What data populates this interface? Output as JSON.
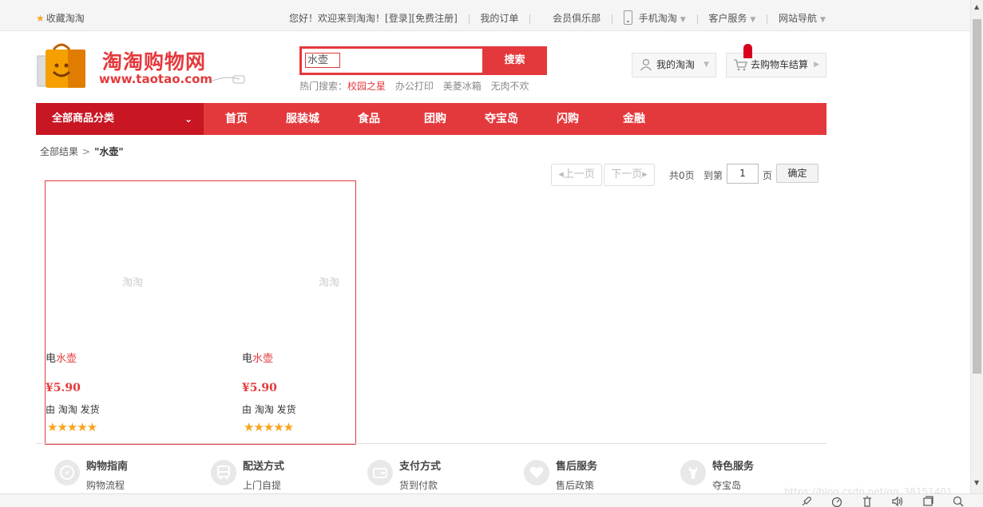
{
  "topbar": {
    "favorite": "收藏淘淘",
    "welcome": "您好！欢迎来到淘淘！",
    "login": "[登录]",
    "register": "[免费注册]",
    "my_orders": "我的订单",
    "member_club": "会员俱乐部",
    "mobile": "手机淘淘",
    "customer_service": "客户服务",
    "site_nav": "网站导航"
  },
  "logo": {
    "cn": "淘淘购物网",
    "en": "www.taotao.com"
  },
  "search": {
    "value": "水壶",
    "button": "搜索",
    "hot_label": "热门搜索：",
    "hot_terms": [
      "校园之星",
      "办公打印",
      "美菱冰箱",
      "无肉不欢"
    ]
  },
  "header_buttons": {
    "my_taotao": "我的淘淘",
    "cart": "去购物车结算"
  },
  "nav": {
    "all_categories": "全部商品分类",
    "items": [
      "首页",
      "服装城",
      "食品",
      "团购",
      "夺宝岛",
      "闪购",
      "金融"
    ]
  },
  "breadcrumb": {
    "root": "全部结果",
    "query": "\"水壶\""
  },
  "pager": {
    "prev": "上一页",
    "next": "下一页",
    "total": "共0页",
    "goto": "到第",
    "page_value": "1",
    "page_unit": "页",
    "confirm": "确定"
  },
  "products": [
    {
      "image_alt": "淘淘",
      "name_prefix": "电",
      "name_keyword": "水壶",
      "price": "¥5.90",
      "shipping": "由 淘淘 发货",
      "rating": 5
    },
    {
      "image_alt": "淘淘",
      "name_prefix": "电",
      "name_keyword": "水壶",
      "price": "¥5.90",
      "shipping": "由 淘淘 发货",
      "rating": 5
    }
  ],
  "services": [
    {
      "title": "购物指南",
      "sub": "购物流程",
      "icon": "compass-icon"
    },
    {
      "title": "配送方式",
      "sub": "上门自提",
      "icon": "bus-icon"
    },
    {
      "title": "支付方式",
      "sub": "货到付款",
      "icon": "wallet-icon"
    },
    {
      "title": "售后服务",
      "sub": "售后政策",
      "icon": "heart-icon"
    },
    {
      "title": "特色服务",
      "sub": "夺宝岛",
      "icon": "wrench-icon"
    }
  ],
  "watermark": "https://blog.csdn.net/qq_38151401",
  "colors": {
    "brand_red": "#e4393c",
    "dark_red": "#c81623",
    "star": "#f7a41d"
  }
}
